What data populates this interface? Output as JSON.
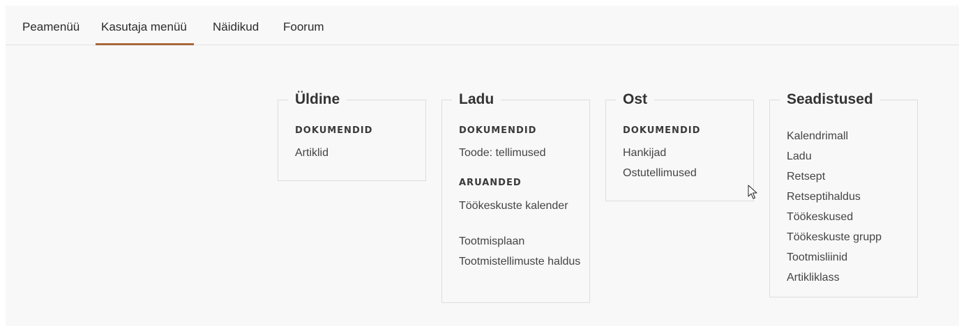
{
  "tabs": [
    {
      "label": "Peamenüü",
      "active": false
    },
    {
      "label": "Kasutaja menüü",
      "active": true
    },
    {
      "label": "Näidikud",
      "active": false
    },
    {
      "label": "Foorum",
      "active": false
    }
  ],
  "groups": {
    "uldine": {
      "title": "Üldine",
      "sections": [
        {
          "heading": "DOKUMENDID",
          "items": [
            "Artiklid"
          ]
        }
      ]
    },
    "ladu": {
      "title": "Ladu",
      "sections": [
        {
          "heading": "DOKUMENDID",
          "items": [
            "Toode: tellimused"
          ]
        },
        {
          "heading": "ARUANDED",
          "items": [
            "Töökeskuste kalender",
            "Tootmisplaan",
            "Tootmistellimuste haldus"
          ]
        }
      ]
    },
    "ost": {
      "title": "Ost",
      "sections": [
        {
          "heading": "DOKUMENDID",
          "items": [
            "Hankijad",
            "Ostutellimused"
          ]
        }
      ]
    },
    "seadistused": {
      "title": "Seadistused",
      "items": [
        "Kalendrimall",
        "Ladu",
        "Retsept",
        "Retseptihaldus",
        "Töökeskused",
        "Töökeskuste grupp",
        "Tootmisliinid",
        "Artikliklass"
      ]
    }
  },
  "colors": {
    "accent": "#a8683b",
    "background": "#f8f8f8",
    "border": "#dddddd"
  },
  "cursor_icon": "mouse-pointer-icon"
}
